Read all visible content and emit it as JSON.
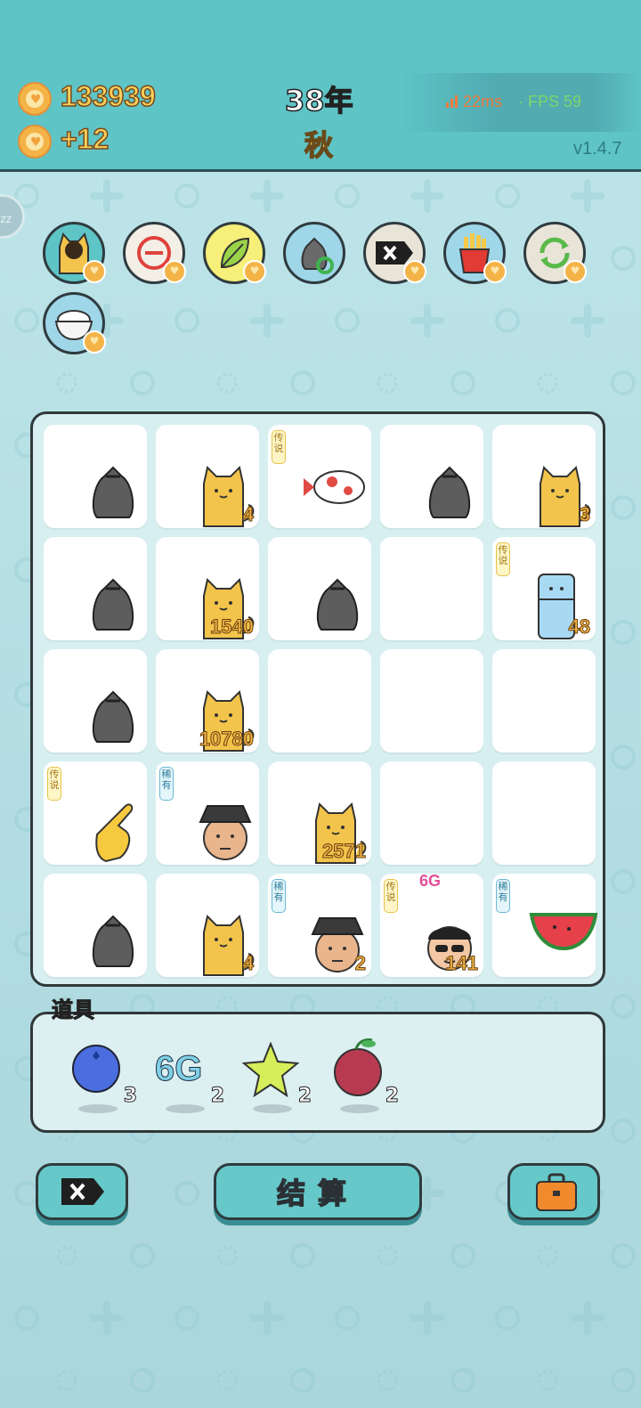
{
  "header": {
    "coins": "133939",
    "income": "+12",
    "year": "38年",
    "season": "秋",
    "ping": "22ms",
    "fps": "· FPS 59",
    "version": "v1.4.7",
    "sleep_badge": "zz"
  },
  "skills": [
    {
      "name": "cat-silhouette-skill",
      "icon": "cat-icon",
      "bg": "#5ec4c6"
    },
    {
      "name": "minus-skill",
      "icon": "minus-circle-icon",
      "bg": "#f3efe6"
    },
    {
      "name": "leaf-skill",
      "icon": "leaf-icon",
      "bg": "#f6ef7a"
    },
    {
      "name": "recycle-bag-skill",
      "icon": "recycle-bag-icon",
      "bg": "#9fd6e8"
    },
    {
      "name": "delete-skill",
      "icon": "delete-icon",
      "bg": "#e9e4d8"
    },
    {
      "name": "fries-skill",
      "icon": "fries-icon",
      "bg": "#9fd6e8"
    },
    {
      "name": "refresh-skill",
      "icon": "refresh-icon",
      "bg": "#e9e4d8"
    },
    {
      "name": "rice-bowl-skill",
      "icon": "rice-bowl-icon",
      "bg": "#9fd6e8"
    }
  ],
  "board": [
    [
      {
        "item": "trash-bag"
      },
      {
        "item": "cat",
        "count": "4"
      },
      {
        "item": "koi-fish",
        "tag": "传说"
      },
      {
        "item": "trash-bag"
      },
      {
        "item": "cat",
        "count": "3"
      }
    ],
    [
      {
        "item": "trash-bag"
      },
      {
        "item": "cat",
        "count": "1540"
      },
      {
        "item": "trash-bag"
      },
      {
        "item": "empty"
      },
      {
        "item": "fridge",
        "tag": "传说",
        "count": "48"
      }
    ],
    [
      {
        "item": "trash-bag"
      },
      {
        "item": "cat",
        "count": "10780"
      },
      {
        "item": "empty"
      },
      {
        "item": "empty"
      },
      {
        "item": "empty"
      }
    ],
    [
      {
        "item": "pointing-hand",
        "tag": "传说"
      },
      {
        "item": "hat-man",
        "tag": "稀有"
      },
      {
        "item": "cat",
        "count": "2571"
      },
      {
        "item": "empty"
      },
      {
        "item": "empty"
      }
    ],
    [
      {
        "item": "trash-bag"
      },
      {
        "item": "cat",
        "count": "4"
      },
      {
        "item": "hat-man",
        "tag": "稀有",
        "count": "2"
      },
      {
        "item": "sunglasses-man",
        "tag": "传说",
        "count": "141",
        "label": "6G"
      },
      {
        "item": "watermelon",
        "tag": "稀有"
      }
    ]
  ],
  "props": {
    "title": "道具",
    "items": [
      {
        "icon": "blue-ball-icon",
        "count": "3"
      },
      {
        "icon": "6g-icon",
        "label": "6G",
        "count": "2"
      },
      {
        "icon": "star-icon",
        "count": "2"
      },
      {
        "icon": "lychee-icon",
        "count": "2"
      }
    ]
  },
  "buttons": {
    "settle_label": "结算"
  },
  "colors": {
    "topbar": "#5ec4c6",
    "accent_gold": "#f7cf5a",
    "legend_tag": "#e5c34a",
    "rare_tag": "#6ab9d2"
  }
}
